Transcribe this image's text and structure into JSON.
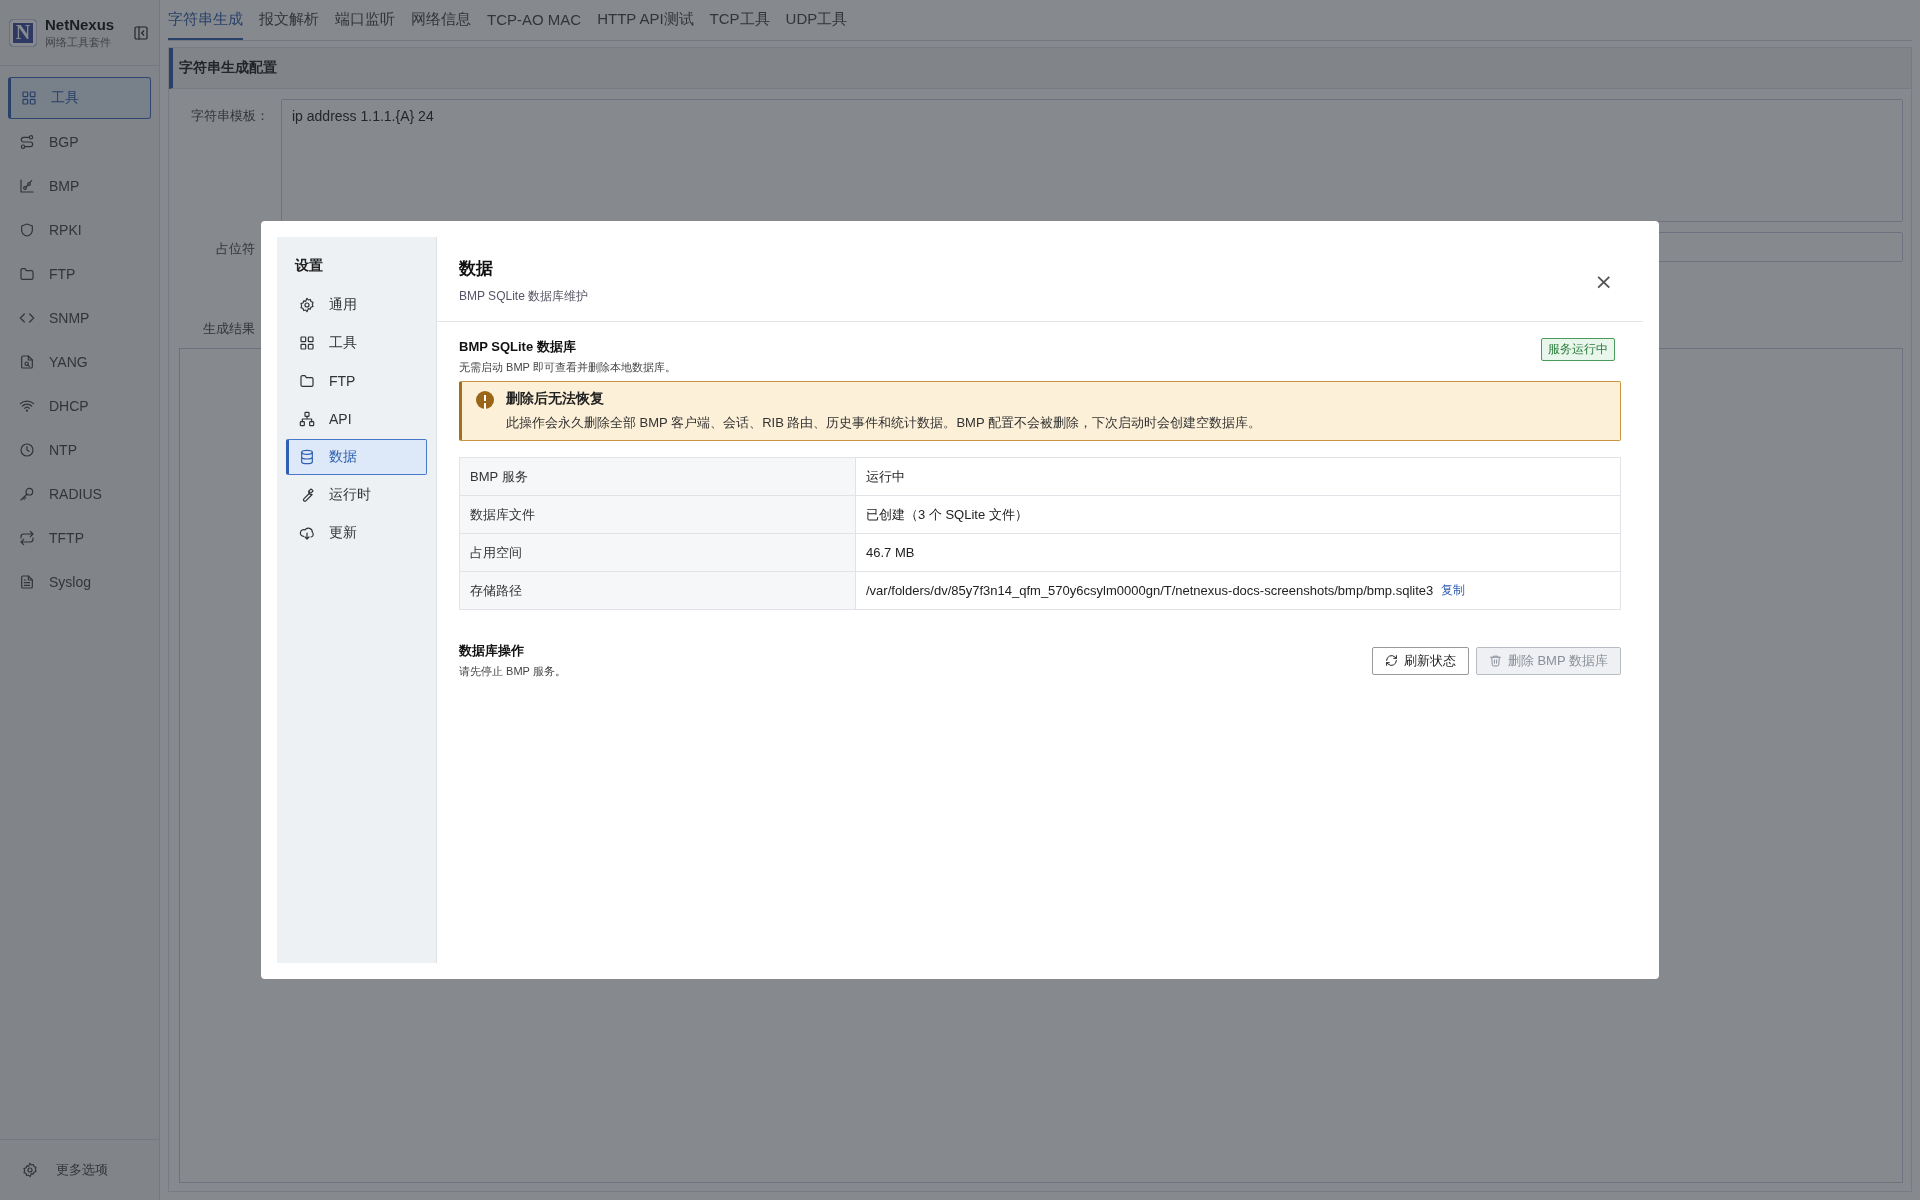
{
  "app": {
    "logo_letter": "N",
    "name": "NetNexus",
    "subtitle": "网络工具套件"
  },
  "sidebar": {
    "items": [
      {
        "label": "工具",
        "selected": true
      },
      {
        "label": "BGP",
        "selected": false
      },
      {
        "label": "BMP",
        "selected": false
      },
      {
        "label": "RPKI",
        "selected": false
      },
      {
        "label": "FTP",
        "selected": false
      },
      {
        "label": "SNMP",
        "selected": false
      },
      {
        "label": "YANG",
        "selected": false
      },
      {
        "label": "DHCP",
        "selected": false
      },
      {
        "label": "NTP",
        "selected": false
      },
      {
        "label": "RADIUS",
        "selected": false
      },
      {
        "label": "TFTP",
        "selected": false
      },
      {
        "label": "Syslog",
        "selected": false
      }
    ],
    "footer": {
      "label": "更多选项"
    }
  },
  "tabs": [
    {
      "label": "字符串生成",
      "selected": true
    },
    {
      "label": "报文解析",
      "selected": false
    },
    {
      "label": "端口监听",
      "selected": false
    },
    {
      "label": "网络信息",
      "selected": false
    },
    {
      "label": "TCP-AO MAC",
      "selected": false
    },
    {
      "label": "HTTP API测试",
      "selected": false
    },
    {
      "label": "TCP工具",
      "selected": false
    },
    {
      "label": "UDP工具",
      "selected": false
    }
  ],
  "config_panel": {
    "title": "字符串生成配置",
    "template": {
      "label": "字符串模板：",
      "value": "ip address 1.1.1.{A} 24"
    },
    "placeholder_field": {
      "label": "占位符"
    },
    "result": {
      "label": "生成结果"
    }
  },
  "dialog": {
    "nav_title": "设置",
    "nav_items": [
      {
        "label": "通用",
        "selected": false
      },
      {
        "label": "工具",
        "selected": false
      },
      {
        "label": "FTP",
        "selected": false
      },
      {
        "label": "API",
        "selected": false
      },
      {
        "label": "数据",
        "selected": true
      },
      {
        "label": "运行时",
        "selected": false
      },
      {
        "label": "更新",
        "selected": false
      }
    ],
    "title": "数据",
    "subtitle": "BMP SQLite 数据库维护",
    "close": "×",
    "section": {
      "title": "BMP SQLite 数据库",
      "description": "无需启动 BMP 即可查看并删除本地数据库。",
      "status_badge": "服务运行中"
    },
    "warning": {
      "title": "删除后无法恢复",
      "message": "此操作会永久删除全部 BMP 客户端、会话、RIB 路由、历史事件和统计数据。BMP 配置不会被删除，下次启动时会创建空数据库。"
    },
    "rows": [
      {
        "label": "BMP 服务",
        "value": "运行中"
      },
      {
        "label": "数据库文件",
        "value": "已创建（3 个 SQLite 文件）"
      },
      {
        "label": "占用空间",
        "value": "46.7 MB"
      },
      {
        "label": "存储路径",
        "value": "/var/folders/dv/85y7f3n14_qfm_570y6csylm0000gn/T/netnexus-docs-screenshots/bmp/bmp.sqlite3",
        "action": "复制"
      }
    ],
    "operations": {
      "title": "数据库操作",
      "description": "请先停止 BMP 服务。",
      "buttons": [
        {
          "label": "刷新状态",
          "disabled": false
        },
        {
          "label": "删除 BMP 数据库",
          "disabled": true
        }
      ]
    }
  }
}
